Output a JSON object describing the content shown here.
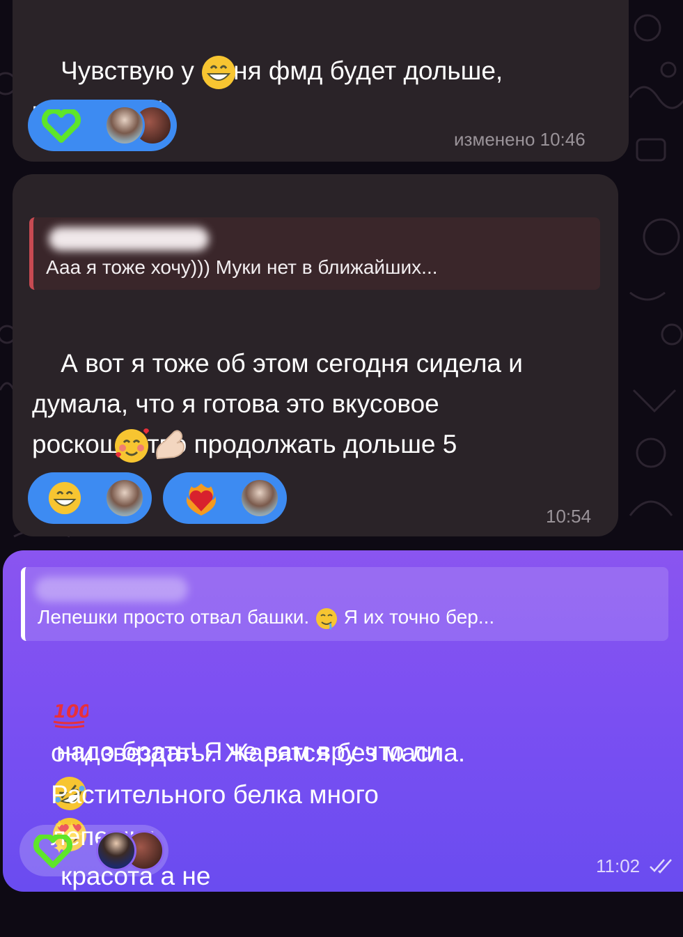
{
  "messages": [
    {
      "type": "incoming",
      "text": "Чувствую у меня фмд будет дольше,\nчем 5 дней",
      "emojis": [
        "grinning-face"
      ],
      "reactions": [
        {
          "emoji": "green-heart",
          "avatars": [
            "user-avatar-1",
            "user-avatar-2"
          ]
        }
      ],
      "time": "изменено 10:46"
    },
    {
      "type": "incoming",
      "reply": {
        "author": "██████████",
        "text": "Ааа я тоже хочу))) Муки нет в ближайших..."
      },
      "text": "А вот я тоже об этом сегодня сидела и\nдумала, что я готова это вкусовое\nроскошество продолжать дольше 5\nдней",
      "emojis": [
        "smiling-face-with-hearts",
        "pinching-hand"
      ],
      "reactions": [
        {
          "emoji": "grinning-face",
          "avatars": [
            "user-avatar-1"
          ]
        },
        {
          "emoji": "heart-on-fire",
          "avatars": [
            "user-avatar-1"
          ]
        }
      ],
      "time": "10:54"
    },
    {
      "type": "outgoing",
      "reply": {
        "author": "██████████",
        "text_part1": "Лепешки просто отвал башки.",
        "text_part2": "Я их точно бер..."
      },
      "line1": "надо брать! Я че вам вру что ли",
      "line2": "они звездаты. Жарятся без масла.",
      "line3a": "Растительного белка много",
      "line3b": "красота а не",
      "line4": "лепешки.",
      "emojis": [
        "hundred-points",
        "rolling-on-floor-laughing",
        "heart-eyes",
        "sparkles"
      ],
      "reactions": [
        {
          "emoji": "green-heart",
          "avatars": [
            "user-avatar-3",
            "user-avatar-2"
          ]
        }
      ],
      "time": "11:02",
      "status": "read-double-check"
    }
  ],
  "colors": {
    "background": "#0e0a14",
    "incoming_bubble": "#2a2328",
    "outgoing_bubble": "#7a4ff2",
    "reaction_chip": "#3d8bf2",
    "reply_accent": "#c84a52",
    "green_heart": "#5ee52a"
  }
}
